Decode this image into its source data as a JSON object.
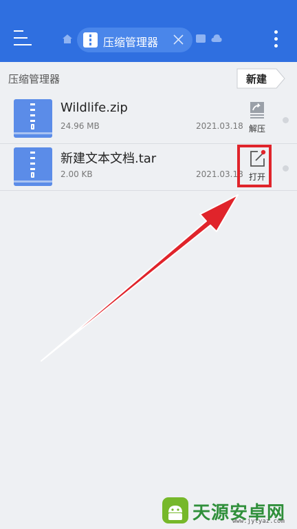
{
  "header": {
    "tab_label": "压缩管理器"
  },
  "toolbar": {
    "breadcrumb": "压缩管理器",
    "new_label": "新建"
  },
  "files": [
    {
      "name": "Wildlife.zip",
      "size": "24.96 MB",
      "date": "2021.03.18",
      "action_label": "解压"
    },
    {
      "name": "新建文本文档.tar",
      "size": "2.00 KB",
      "date": "2021.03.18",
      "action_label": "打开"
    }
  ],
  "watermark": {
    "text": "天源安卓网",
    "url": "www.jytyaz.com"
  },
  "colors": {
    "appbar": "#2f6fe0",
    "file_icon": "#5b8ce8",
    "annotation_red": "#e0242b"
  }
}
